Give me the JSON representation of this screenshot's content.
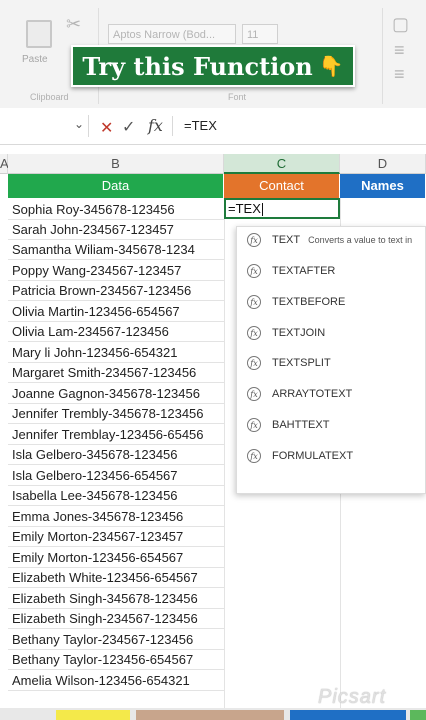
{
  "ribbon": {
    "paste_label": "Paste",
    "clipboard_label": "Clipboard",
    "font_label": "Font",
    "font_name": "Aptos Narrow (Bod...",
    "font_size": "11"
  },
  "banner": {
    "text": "Try this Function",
    "emoji": "👇"
  },
  "formula_bar": {
    "content": "=TEX"
  },
  "columns": {
    "a": "A",
    "b": "B",
    "c": "C",
    "d": "D"
  },
  "headers": {
    "data": "Data",
    "contact": "Contact",
    "names": "Names"
  },
  "active_cell": {
    "value": "=TEX"
  },
  "rows": [
    "Sophia Roy-345678-123456",
    "Sarah John-234567-123457",
    "Samantha Wiliam-345678-1234",
    "Poppy Wang-234567-123457",
    "Patricia Brown-234567-123456",
    "Olivia Martin-123456-654567",
    "Olivia Lam-234567-123456",
    "Mary li John-123456-654321",
    "Margaret Smith-234567-123456",
    "Joanne Gagnon-345678-123456",
    "Jennifer Trembly-345678-123456",
    "Jennifer Tremblay-123456-65456",
    "Isla Gelbero-345678-123456",
    "Isla Gelbero-123456-654567",
    "Isabella Lee-345678-123456",
    "Emma Jones-345678-123456",
    "Emily Morton-234567-123457",
    "Emily Morton-123456-654567",
    "Elizabeth White-123456-654567",
    "Elizabeth Singh-345678-123456",
    "Elizabeth Singh-234567-123456",
    "Bethany Taylor-234567-123456",
    "Bethany Taylor-123456-654567",
    "Amelia Wilson-123456-654321"
  ],
  "autocomplete": {
    "items": [
      {
        "name": "TEXT",
        "desc": "Converts a value to text in"
      },
      {
        "name": "TEXTAFTER"
      },
      {
        "name": "TEXTBEFORE"
      },
      {
        "name": "TEXTJOIN"
      },
      {
        "name": "TEXTSPLIT"
      },
      {
        "name": "ARRAYTOTEXT"
      },
      {
        "name": "BAHTTEXT"
      },
      {
        "name": "FORMULATEXT"
      }
    ]
  },
  "watermark": "Picsart",
  "colors": {
    "green": "#21a84d",
    "orange": "#e3742b",
    "blue": "#1f6fc5"
  }
}
